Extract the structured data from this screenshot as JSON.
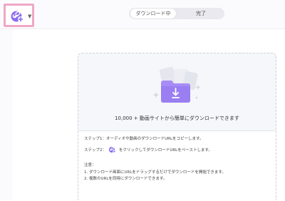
{
  "header": {
    "add_button_icon": "link-plus-icon",
    "tabs": [
      {
        "label": "ダウンロード中",
        "active": true
      },
      {
        "label": "完了",
        "active": false
      }
    ]
  },
  "main": {
    "illustration_icon": "download-folder-icon",
    "headline": "10,000 + 動画サイトから簡単にダウンロードできます",
    "step1": "ステップ1：オーディオや動画のダウンロードURLをコピーします。",
    "step2_prefix": "ステップ2：",
    "step2_suffix": "をクリックしてダウンロードURLをペーストします。",
    "notes_title": "注意：",
    "note1": "1. ダウンロード画面にURLをドラッグするだけでダウンロードを開始できます。",
    "note2": "2. 複数のURLを同時にダウンロードできます。"
  },
  "colors": {
    "accent": "#8a6cf0",
    "highlight_border": "#f0a7c6",
    "folder": "#a78cf5"
  }
}
